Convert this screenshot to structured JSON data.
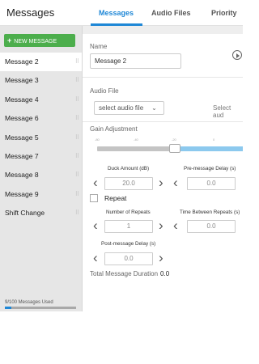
{
  "header": {
    "app_title": "Messages",
    "tabs": [
      {
        "label": "Messages",
        "active": true
      },
      {
        "label": "Audio Files",
        "active": false
      },
      {
        "label": "Priority",
        "active": false
      }
    ]
  },
  "sidebar": {
    "new_button_label": "NEW MESSAGE",
    "messages": [
      {
        "label": "Message 2",
        "selected": true
      },
      {
        "label": "Message 3"
      },
      {
        "label": "Message 4"
      },
      {
        "label": "Message 6"
      },
      {
        "label": "Message 5"
      },
      {
        "label": "Message 7"
      },
      {
        "label": "Message 8"
      },
      {
        "label": "Message 9"
      },
      {
        "label": "Shift Change"
      }
    ],
    "usage_label": "9/100 Messages Used",
    "usage_fraction": 0.09
  },
  "editor": {
    "name_label": "Name",
    "name_value": "Message 2",
    "audio_file_label": "Audio File",
    "audio_select_value": "select audio file",
    "audio_select_value_2": "Select aud",
    "gain_label": "Gain Adjustment",
    "gain_ticks": [
      "-80",
      "-40",
      "-20",
      "0"
    ],
    "gain_value_db": -20,
    "duck_amount_label": "Duck Amount (dB)",
    "duck_amount_value": "20.0",
    "pre_delay_label": "Pre-message Delay (s)",
    "pre_delay_value": "0.0",
    "repeat_label": "Repeat",
    "repeat_checked": false,
    "num_repeats_label": "Number of Repeats",
    "num_repeats_value": "1",
    "time_between_label": "Time Between Repeats (s)",
    "time_between_value": "0.0",
    "post_delay_label": "Post-message Delay (s)",
    "post_delay_value": "0.0",
    "total_duration_label": "Total Message Duration",
    "total_duration_value": "0.0"
  },
  "colors": {
    "accent": "#1f87d6",
    "new_button": "#4cae4c",
    "slider_fill": "#8cc9ee"
  },
  "icons": {
    "play": "play-circle-icon",
    "chevron_down": "chevron-down-icon",
    "chevron_left": "chevron-left-icon",
    "chevron_right": "chevron-right-icon",
    "drag": "drag-handle-icon"
  }
}
